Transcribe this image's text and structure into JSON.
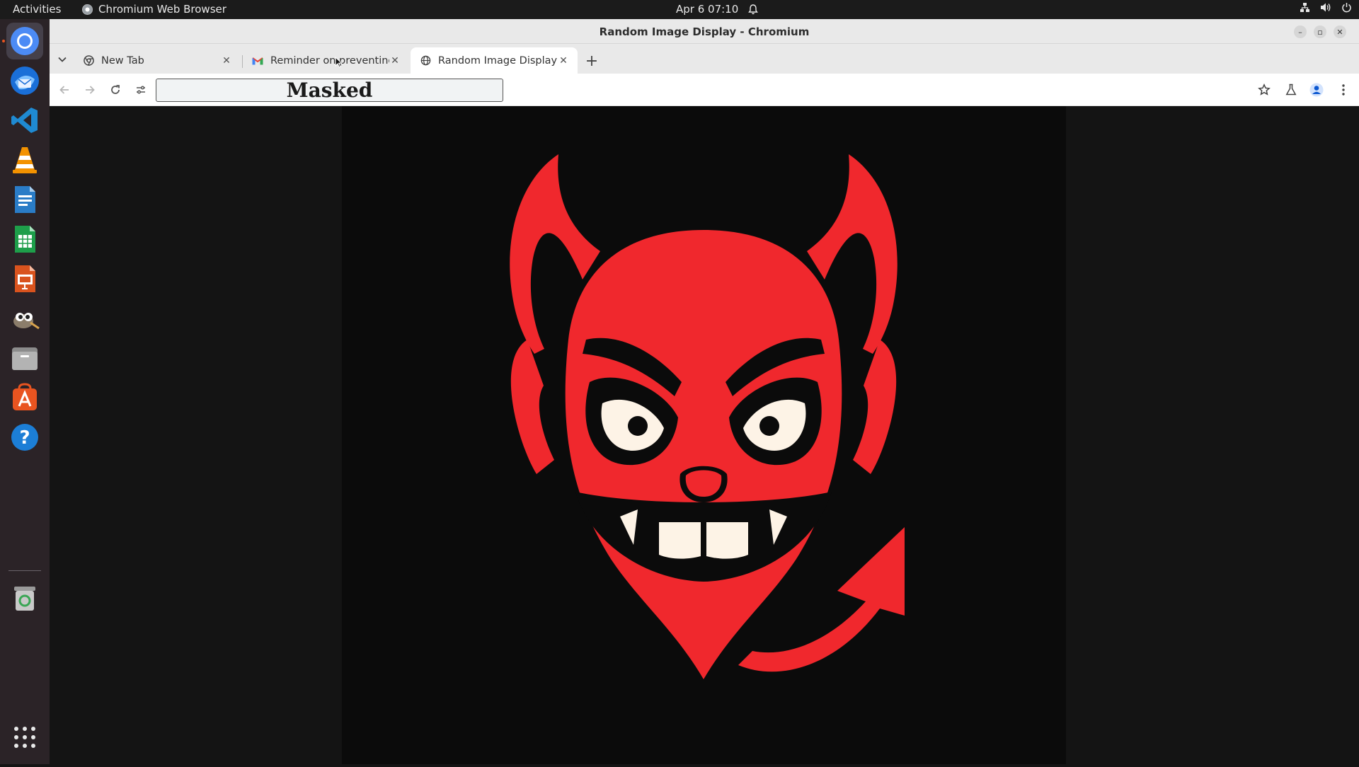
{
  "topbar": {
    "activities": "Activities",
    "app_name": "Chromium Web Browser",
    "clock": "Apr 6  07:10"
  },
  "dock": {
    "items": [
      {
        "name": "chromium-icon",
        "active": true
      },
      {
        "name": "thunderbird-icon"
      },
      {
        "name": "vscode-icon"
      },
      {
        "name": "vlc-icon"
      },
      {
        "name": "writer-icon"
      },
      {
        "name": "calc-icon"
      },
      {
        "name": "impress-icon"
      },
      {
        "name": "gimp-icon"
      },
      {
        "name": "files-icon"
      },
      {
        "name": "app-center-icon"
      },
      {
        "name": "help-icon"
      },
      {
        "name": "trash-icon"
      },
      {
        "name": "show-apps-icon"
      }
    ]
  },
  "window": {
    "title": "Random Image Display - Chromium"
  },
  "tabs": [
    {
      "label": "New Tab",
      "icon": "chrome-icon"
    },
    {
      "label": "Reminder on preventing",
      "icon": "gmail-icon"
    },
    {
      "label": "Random Image Display",
      "icon": "globe-icon",
      "active": true
    }
  ],
  "toolbar": {
    "url": "Masked"
  },
  "colors": {
    "devil_red": "#f0282d",
    "eye_white": "#fdf3e6",
    "image_bg": "#0b0b0b"
  }
}
